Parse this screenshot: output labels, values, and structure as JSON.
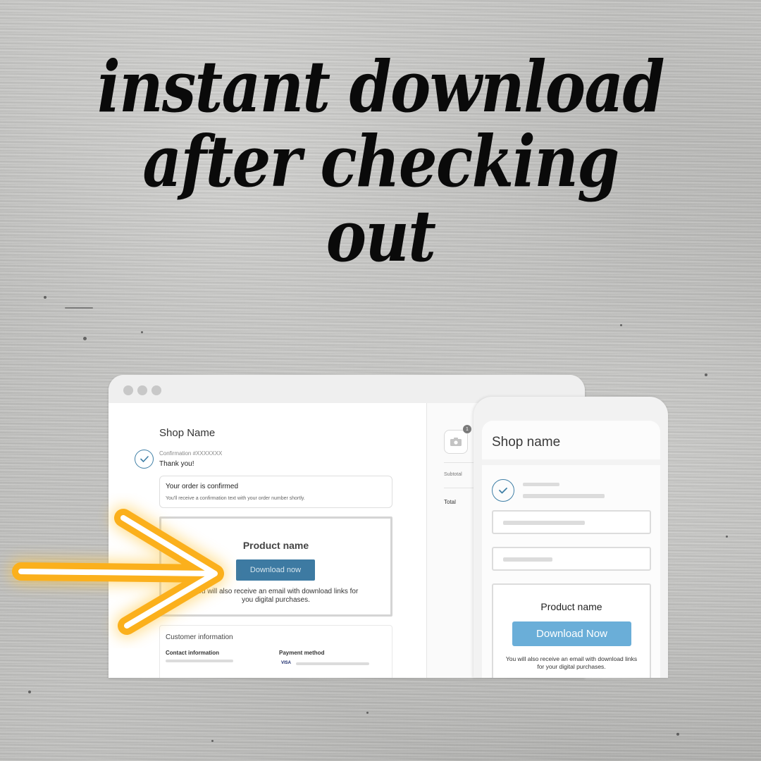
{
  "headline": {
    "line1": "instant download",
    "line2": "after checking",
    "line3": "out"
  },
  "desktop": {
    "window_controls": [
      "close",
      "minimize",
      "maximize"
    ],
    "shop_name": "Shop Name",
    "confirmation_number": "Confirmation #XXXXXXX",
    "thank_you": "Thank you!",
    "order_box": {
      "title": "Your order is confirmed",
      "subtitle": "You'll receive a confirmation text with your order number shortly."
    },
    "product": {
      "name": "Product name",
      "download_label": "Download now",
      "note": "You will also receive an email with download links for you digital purchases."
    },
    "customer": {
      "title": "Customer information",
      "contact_label": "Contact information",
      "payment_label": "Payment method",
      "card_brand": "VISA"
    },
    "summary": {
      "cart_badge_count": "1",
      "subtotal_label": "Subtotal",
      "total_label": "Total"
    }
  },
  "mobile": {
    "shop_name": "Shop name",
    "product": {
      "name": "Product name",
      "download_label": "Download Now",
      "note": "You will also receive an email with download links for your digital purchases."
    }
  },
  "colors": {
    "accent_blue": "#3d7aa2",
    "mobile_button": "#6aaed8",
    "arrow_orange": "#fbb01c",
    "check_blue": "#3f7fa6"
  },
  "icons": {
    "check": "check-icon",
    "camera": "camera-icon",
    "arrow": "arrow-right-icon"
  }
}
